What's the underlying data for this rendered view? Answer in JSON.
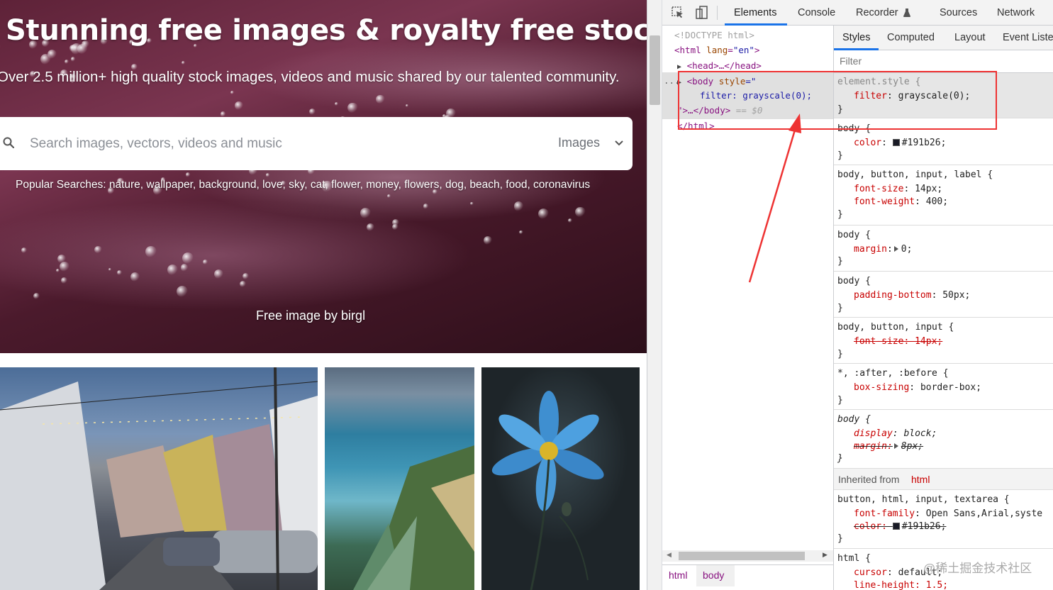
{
  "hero": {
    "title": "Stunning free images & royalty free stock",
    "subtitle": "Over 2.5 million+ high quality stock images, videos and music shared by our talented community.",
    "search_placeholder": "Search images, vectors, videos and music",
    "media_type": "Images",
    "popular_searches": "Popular Searches: nature, wallpaper, background, love, sky, cat, flower, money, flowers, dog, beach, food, coronavirus",
    "credit": "Free image by birgl"
  },
  "devtools": {
    "tabs": [
      "Elements",
      "Console",
      "Recorder",
      "Sources",
      "Network"
    ],
    "active_tab": "Elements",
    "dom": {
      "doctype": "<!DOCTYPE html>",
      "html_open": "<html",
      "lang_attr": "lang",
      "lang_val": "\"en\"",
      "head": "<head>…</head>",
      "body_open": "<body",
      "style_attr": "style",
      "style_eq": "=\"",
      "filter_line": "filter: grayscale(0);",
      "body_close": "\">…</body>",
      "eq_sel": "== $0",
      "html_close": "</html>",
      "dots": "..."
    },
    "styles_tabs": [
      "Styles",
      "Computed",
      "Layout",
      "Event Liste"
    ],
    "filter_placeholder": "Filter",
    "rules": {
      "r1_sel": "element.style {",
      "r1_prop": "filter",
      "r1_val": "grayscale(0);",
      "r2_sel": "body {",
      "r2_prop": "color",
      "r2_val": "#191b26;",
      "r3_sel": "body, button, input, label {",
      "r3_p1": "font-size",
      "r3_v1": "14px;",
      "r3_p2": "font-weight",
      "r3_v2": "400;",
      "r4_sel": "body {",
      "r4_prop": "margin",
      "r4_val": "0;",
      "r5_sel": "body {",
      "r5_prop": "padding-bottom",
      "r5_val": "50px;",
      "r6_sel": "body, button, input {",
      "r6_prop": "font-size: 14px;",
      "r7_sel": "*, :after, :before {",
      "r7_prop": "box-sizing",
      "r7_val": "border-box;",
      "r8_sel": "body {",
      "r8_p1": "display",
      "r8_v1": "block;",
      "r8_p2": "margin:",
      "r8_v2": "8px;",
      "inherited_label": "Inherited from",
      "inherited_tag": "html",
      "r9_sel": "button, html, input, textarea {",
      "r9_p1": "font-family",
      "r9_v1": "Open Sans,Arial,syste",
      "r9_p2": "color:",
      "r9_v2": "#191b26;",
      "r10_sel": "html {",
      "r10_p1": "cursor",
      "r10_v1": "default;",
      "r10_p2": "line-height: 1.5;",
      "close": "}"
    },
    "breadcrumbs": [
      "html",
      "body"
    ]
  },
  "watermark": "@稀土掘金技术社区",
  "colors": {
    "accent": "#1a73e8",
    "annotation": "#ee3333"
  }
}
